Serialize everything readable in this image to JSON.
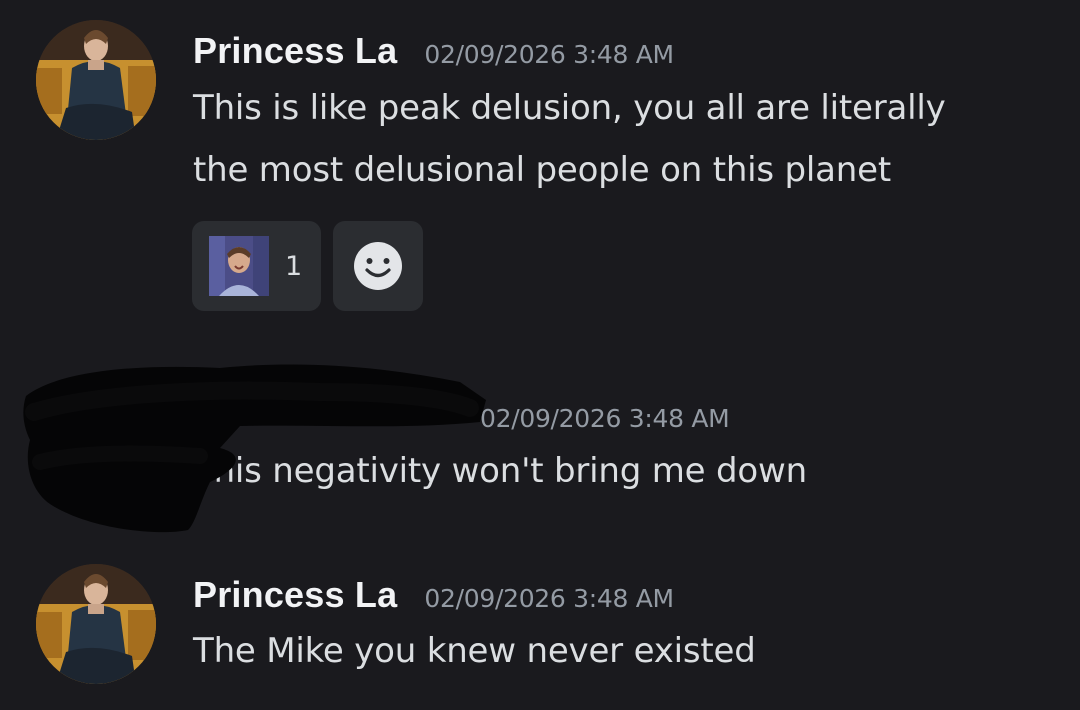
{
  "messages": [
    {
      "username": "Princess La",
      "timestamp": "02/09/2026 3:48 AM",
      "lines": [
        "This is like peak delusion, you all are literally",
        "the most delusional people on this planet"
      ],
      "reactions": [
        {
          "emoji": "person-photo-emoji",
          "count": "1"
        }
      ],
      "add_reaction_icon": "smiley-face-icon"
    },
    {
      "username": "",
      "timestamp": "02/09/2026 3:48 AM",
      "lines": [
        "This negativity won't bring me down"
      ]
    },
    {
      "username": "Princess La",
      "timestamp": "02/09/2026 3:48 AM",
      "lines": [
        "The Mike you knew never existed"
      ]
    }
  ],
  "colors": {
    "background": "#1a1a1e",
    "username": "#f2f3f5",
    "timestamp": "#949ba4",
    "message_text": "#dbdee1",
    "reaction_bg": "#2b2d31"
  }
}
